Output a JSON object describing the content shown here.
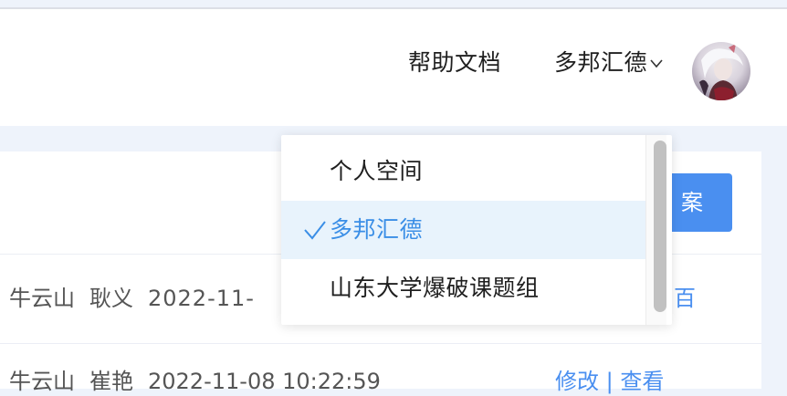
{
  "header": {
    "help_label": "帮助文档",
    "org_name": "多邦汇德",
    "avatar_icon": "user-avatar"
  },
  "toolbar": {
    "primary_button_label": "案"
  },
  "table": {
    "rows": [
      {
        "cells": [
          "牛云山",
          "耿义",
          "2022-11-"
        ],
        "action": "百"
      },
      {
        "cells": [
          "牛云山",
          "崔艳",
          "2022-11-08 10:22:59"
        ],
        "action": "修改 | 查看"
      }
    ]
  },
  "org_dropdown": {
    "items": [
      {
        "label": "个人空间",
        "selected": false
      },
      {
        "label": "多邦汇德",
        "selected": true
      },
      {
        "label": "山东大学爆破课题组",
        "selected": false
      }
    ],
    "selected_color": "#3a8ee6",
    "selected_bg": "#e8f3fc"
  },
  "colors": {
    "accent": "#4a8ff0",
    "page_bg": "#eef3fb"
  }
}
